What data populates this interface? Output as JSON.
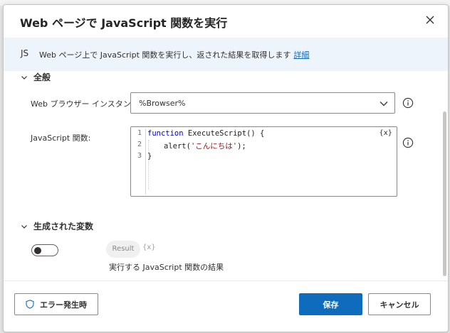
{
  "dialog": {
    "title": "Web ページで JavaScript 関数を実行",
    "close_icon": "close-icon"
  },
  "info": {
    "badge": "JS",
    "text": "Web ページ上で JavaScript 関数を実行し、返された結果を取得します",
    "link": "詳細"
  },
  "general": {
    "header": "全般",
    "browser_label": "Web ブラウザー インスタンス:",
    "browser_value": "%Browser%",
    "js_label": "JavaScript 関数:",
    "var_button": "{x}",
    "code": {
      "line_numbers": [
        "1",
        "2",
        "3"
      ],
      "line1_kw": "function",
      "line1_rest": " ExecuteScript() {",
      "line2_pre": "alert(",
      "line2_str": "'こんにちは'",
      "line2_post": ");",
      "line3": "}"
    }
  },
  "variables": {
    "header": "生成された変数",
    "toggle_on": false,
    "result_name": "Result",
    "result_var_icon": "{x}",
    "result_desc": "実行する JavaScript 関数の結果"
  },
  "footer": {
    "error_button": "エラー発生時",
    "save_button": "保存",
    "cancel_button": "キャンセル"
  },
  "colors": {
    "accent": "#0f6cbd",
    "info_bg": "#eef4fb"
  }
}
